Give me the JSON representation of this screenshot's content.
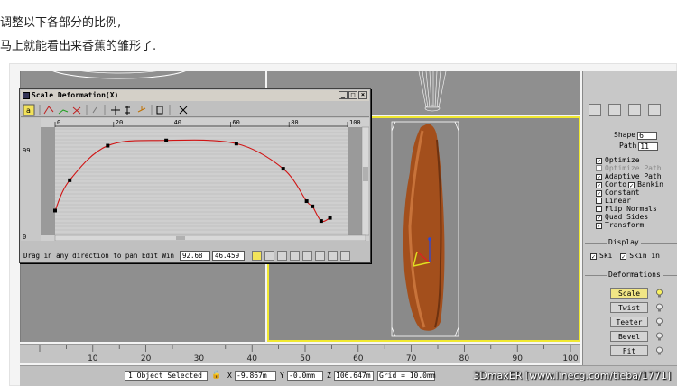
{
  "caption": {
    "line1": "调整以下各部分的比例,",
    "line2": "马上就能看出来香蕉的雏形了."
  },
  "deform_window": {
    "title": "Scale Deformation(X)",
    "status_message": "Drag in any direction to pan Edit Win",
    "value_1": "92.68",
    "value_2": "46.459",
    "top_ruler": [
      "0",
      "20",
      "40",
      "60",
      "80",
      "100"
    ],
    "y_label_top": "99",
    "y_label_bottom": "0",
    "curve_points": [
      [
        0,
        22
      ],
      [
        5,
        51
      ],
      [
        18,
        84
      ],
      [
        38,
        89
      ],
      [
        62,
        86
      ],
      [
        78,
        62
      ],
      [
        86,
        31
      ],
      [
        88,
        26
      ],
      [
        91,
        12
      ],
      [
        94,
        15
      ]
    ]
  },
  "command_panel": {
    "shape_label": "Shape",
    "shape_value": "6",
    "path_label": "Path",
    "path_value": "11",
    "options": [
      {
        "label": "Optimize",
        "checked": true,
        "dim": false
      },
      {
        "label": "Optimize Path",
        "checked": false,
        "dim": true
      },
      {
        "label": "Adaptive Path",
        "checked": true,
        "dim": false
      },
      {
        "label": "Conto",
        "checked": true,
        "dim": false
      },
      {
        "label": "Constant",
        "checked": true,
        "dim": false
      },
      {
        "label": "Linear",
        "checked": false,
        "dim": false
      },
      {
        "label": "Flip Normals",
        "checked": false,
        "dim": false
      },
      {
        "label": "Quad Sides",
        "checked": true,
        "dim": false
      },
      {
        "label": "Transform",
        "checked": true,
        "dim": false
      }
    ],
    "banking_label": "Bankin",
    "display_label": "Display",
    "skin_label": "Ski",
    "skin_in_label": "Skin in",
    "deformations_label": "Deformations",
    "deformations": [
      "Scale",
      "Twist",
      "Teeter",
      "Bevel",
      "Fit"
    ]
  },
  "ruler": {
    "ticks": [
      "10",
      "20",
      "30",
      "40",
      "50",
      "60",
      "70",
      "80",
      "90",
      "100"
    ]
  },
  "status_bar": {
    "selected": "1 Object Selected",
    "x_label": "X",
    "x_value": "-9.867m",
    "y_label": "Y",
    "y_value": "-0.0mm",
    "z_label": "Z",
    "z_value": "106.647m",
    "grid": "Grid = 10.0mm"
  },
  "watermark": "3DmaxER  [www.linecg.com/tieba/1771]",
  "colors": {
    "curve": "#d01414",
    "viewport_border": "#f0e830",
    "banana": "#a34f1c",
    "active_button": "#f3e35a"
  }
}
